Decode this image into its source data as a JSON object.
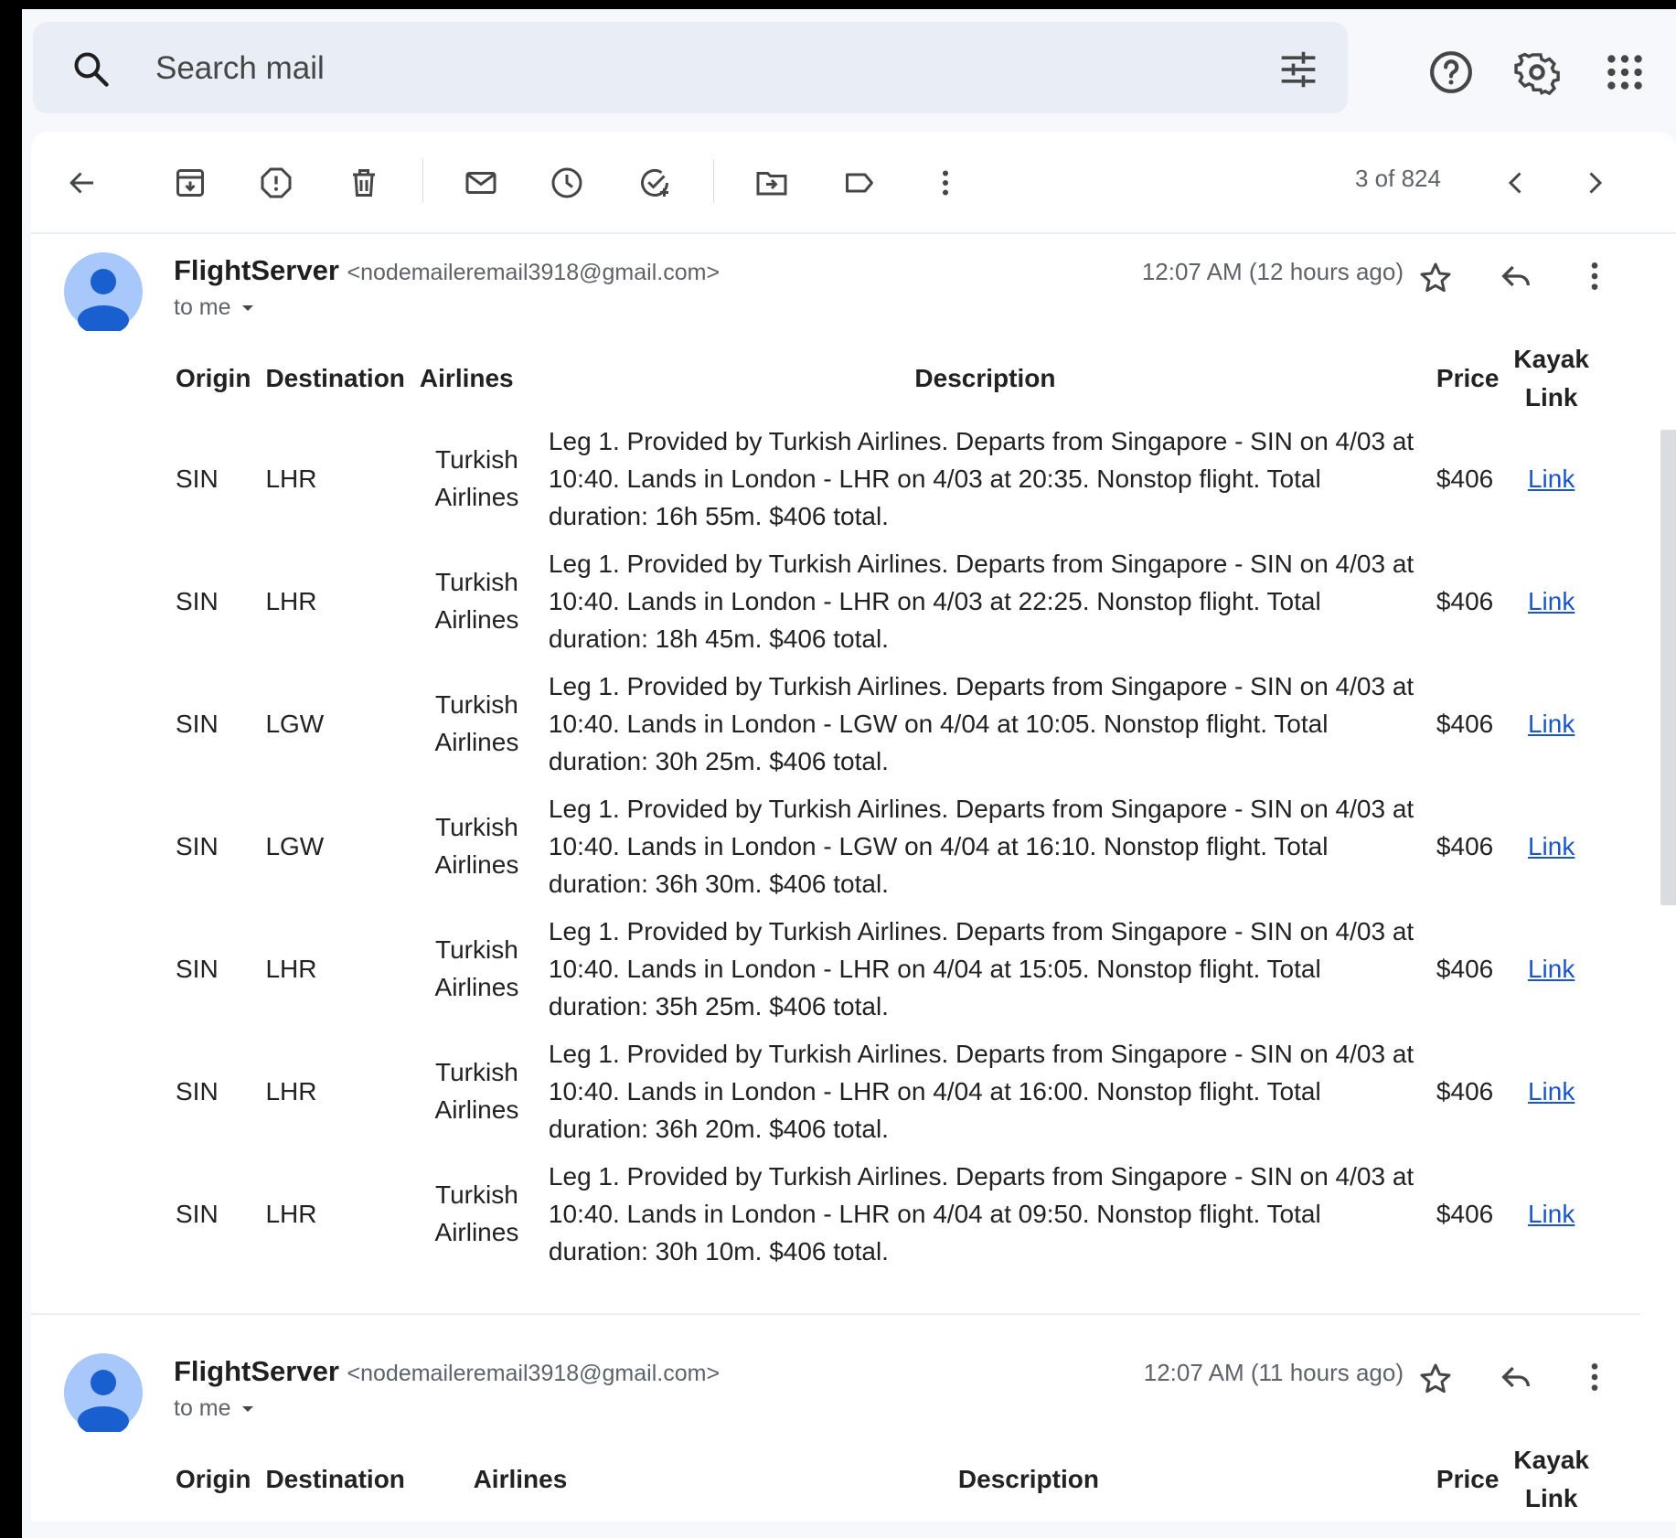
{
  "search": {
    "placeholder": "Search mail"
  },
  "toolbar": {
    "pager": "3 of 824"
  },
  "messages": [
    {
      "sender_name": "FlightServer",
      "sender_email": "<nodemaileremail3918@gmail.com>",
      "to": "to me",
      "time": "12:07 AM (12 hours ago)",
      "headers": {
        "origin": "Origin",
        "destination": "Destination",
        "airlines": "Airlines",
        "description": "Description",
        "price": "Price",
        "link": "Kayak Link"
      },
      "rows": [
        {
          "origin": "SIN",
          "destination": "LHR",
          "airline": "Turkish Airlines",
          "description": "Leg 1. Provided by Turkish Airlines. Departs from Singapore - SIN on 4/03 at 10:40. Lands in London - LHR on 4/03 at 20:35. Nonstop flight. Total duration: 16h 55m. $406 total.",
          "price": "$406",
          "link": "Link"
        },
        {
          "origin": "SIN",
          "destination": "LHR",
          "airline": "Turkish Airlines",
          "description": "Leg 1. Provided by Turkish Airlines. Departs from Singapore - SIN on 4/03 at 10:40. Lands in London - LHR on 4/03 at 22:25. Nonstop flight. Total duration: 18h 45m. $406 total.",
          "price": "$406",
          "link": "Link"
        },
        {
          "origin": "SIN",
          "destination": "LGW",
          "airline": "Turkish Airlines",
          "description": "Leg 1. Provided by Turkish Airlines. Departs from Singapore - SIN on 4/03 at 10:40. Lands in London - LGW on 4/04 at 10:05. Nonstop flight. Total duration: 30h 25m. $406 total.",
          "price": "$406",
          "link": "Link"
        },
        {
          "origin": "SIN",
          "destination": "LGW",
          "airline": "Turkish Airlines",
          "description": "Leg 1. Provided by Turkish Airlines. Departs from Singapore - SIN on 4/03 at 10:40. Lands in London - LGW on 4/04 at 16:10. Nonstop flight. Total duration: 36h 30m. $406 total.",
          "price": "$406",
          "link": "Link"
        },
        {
          "origin": "SIN",
          "destination": "LHR",
          "airline": "Turkish Airlines",
          "description": "Leg 1. Provided by Turkish Airlines. Departs from Singapore - SIN on 4/03 at 10:40. Lands in London - LHR on 4/04 at 15:05. Nonstop flight. Total duration: 35h 25m. $406 total.",
          "price": "$406",
          "link": "Link"
        },
        {
          "origin": "SIN",
          "destination": "LHR",
          "airline": "Turkish Airlines",
          "description": "Leg 1. Provided by Turkish Airlines. Departs from Singapore - SIN on 4/03 at 10:40. Lands in London - LHR on 4/04 at 16:00. Nonstop flight. Total duration: 36h 20m. $406 total.",
          "price": "$406",
          "link": "Link"
        },
        {
          "origin": "SIN",
          "destination": "LHR",
          "airline": "Turkish Airlines",
          "description": "Leg 1. Provided by Turkish Airlines. Departs from Singapore - SIN on 4/03 at 10:40. Lands in London - LHR on 4/04 at 09:50. Nonstop flight. Total duration: 30h 10m. $406 total.",
          "price": "$406",
          "link": "Link"
        }
      ]
    },
    {
      "sender_name": "FlightServer",
      "sender_email": "<nodemaileremail3918@gmail.com>",
      "to": "to me",
      "time": "12:07 AM (11 hours ago)",
      "headers": {
        "origin": "Origin",
        "destination": "Destination",
        "airlines": "Airlines",
        "description": "Description",
        "price": "Price",
        "link": "Kayak Link"
      }
    }
  ]
}
